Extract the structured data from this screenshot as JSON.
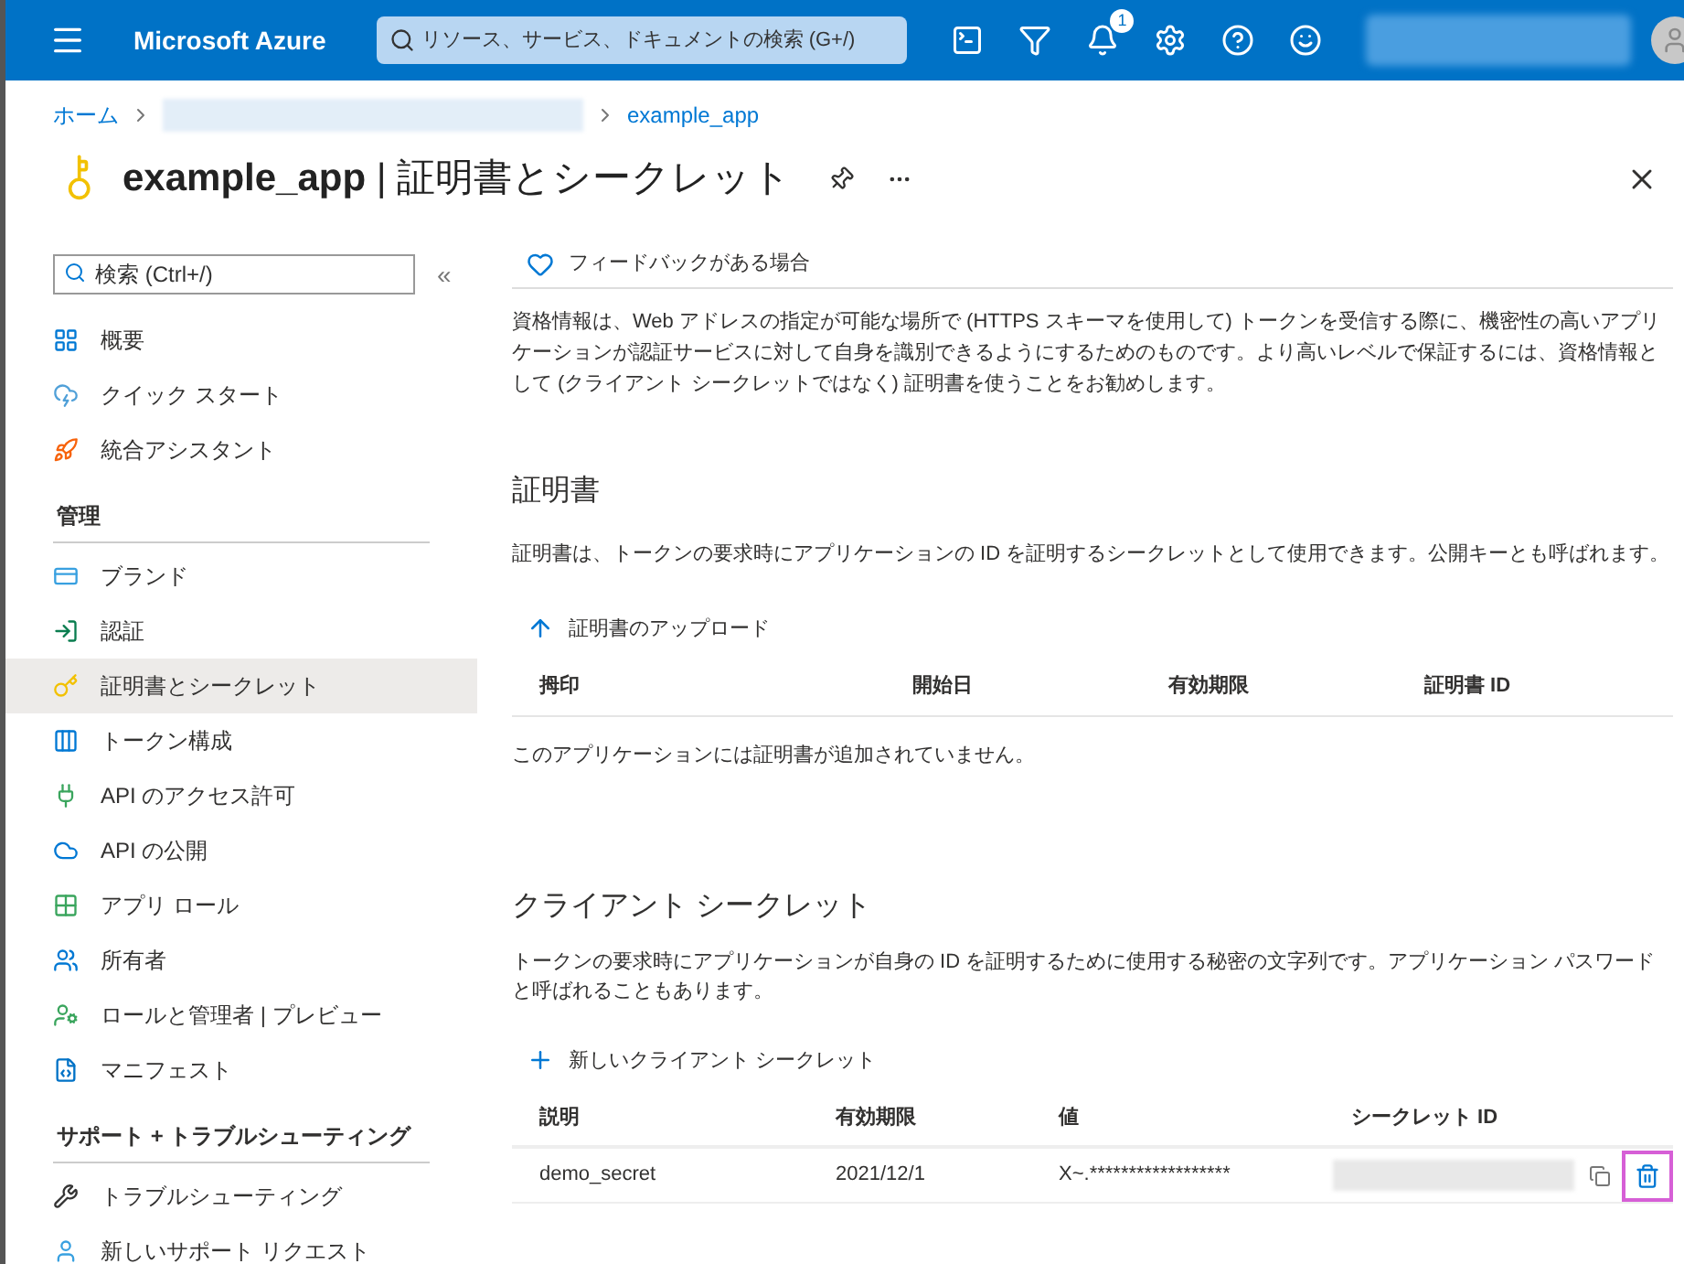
{
  "topbar": {
    "brand": "Microsoft Azure",
    "search": {
      "placeholder": "リソース、サービス、ドキュメントの検索 (G+/)"
    },
    "notification_count": "1"
  },
  "breadcrumb": [
    {
      "kind": "link",
      "label": "ホーム"
    },
    {
      "kind": "blurred"
    },
    {
      "kind": "link",
      "label": "example_app"
    }
  ],
  "page_title": "**example_app** | 証明書とシークレット",
  "sidebar": {
    "search": {
      "placeholder": "検索 (Ctrl+/)"
    },
    "collapse": "«",
    "groups": [
      {
        "items": [
          {
            "label": "概要",
            "selected": false
          },
          {
            "label": "クイック スタート",
            "selected": false
          },
          {
            "label": "統合アシスタント",
            "selected": false
          }
        ]
      },
      {
        "heading": "管理",
        "items": [
          {
            "label": "ブランド",
            "selected": false
          },
          {
            "label": "認証",
            "selected": false
          },
          {
            "label": "証明書とシークレット",
            "selected": true
          },
          {
            "label": "トークン構成",
            "selected": false
          },
          {
            "label": "API のアクセス許可",
            "selected": false
          },
          {
            "label": "API の公開",
            "selected": false
          },
          {
            "label": "アプリ ロール",
            "selected": false
          },
          {
            "label": "所有者",
            "selected": false
          },
          {
            "label": "ロールと管理者 | プレビュー",
            "selected": false
          },
          {
            "label": "マニフェスト",
            "selected": false
          }
        ]
      },
      {
        "heading": "サポート + トラブルシューティング",
        "items": [
          {
            "label": "トラブルシューティング",
            "selected": false
          },
          {
            "label": "新しいサポート リクエスト",
            "selected": false
          }
        ]
      }
    ]
  },
  "content": {
    "feedback": "フィードバックがある場合",
    "intro": "資格情報は、Web アドレスの指定が可能な場所で (HTTPS スキーマを使用して) トークンを受信する際に、機密性の高いアプリケーションが認証サービスに対して自身を識別できるようにするためのものです。より高いレベルで保証するには、資格情報として (クライアント シークレットではなく) 証明書を使うことをお勧めします。",
    "certificates": {
      "heading": "証明書",
      "description": "証明書は、トークンの要求時にアプリケーションの ID を証明するシークレットとして使用できます。公開キーとも呼ばれます。",
      "action": "証明書のアップロード",
      "columns": [
        "拇印",
        "開始日",
        "有効期限",
        "証明書 ID"
      ],
      "empty": "このアプリケーションには証明書が追加されていません。"
    },
    "secrets": {
      "heading": "クライアント シークレット",
      "description": "トークンの要求時にアプリケーションが自身の ID を証明するために使用する秘密の文字列です。アプリケーション パスワードと呼ばれることもあります。",
      "action": "新しいクライアント シークレット",
      "columns": [
        "説明",
        "有効期限",
        "値",
        "シークレット ID"
      ],
      "rows": [
        {
          "description": "demo_secret",
          "expires": "2021/12/1",
          "value": "X~.******************",
          "secret_id_blurred": true,
          "delete_highlighted": true
        }
      ]
    }
  }
}
